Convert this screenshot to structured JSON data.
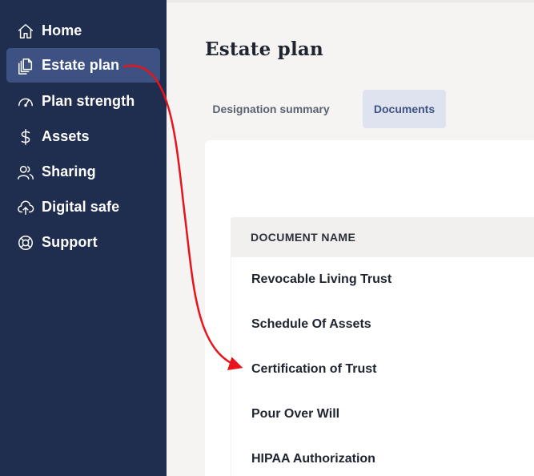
{
  "sidebar": {
    "items": [
      {
        "label": "Home",
        "icon": "home-icon"
      },
      {
        "label": "Estate plan",
        "icon": "documents-icon",
        "active": true
      },
      {
        "label": "Plan strength",
        "icon": "gauge-icon"
      },
      {
        "label": "Assets",
        "icon": "dollar-icon"
      },
      {
        "label": "Sharing",
        "icon": "people-icon"
      },
      {
        "label": "Digital safe",
        "icon": "cloud-upload-icon"
      },
      {
        "label": "Support",
        "icon": "lifebuoy-icon"
      }
    ]
  },
  "main": {
    "title": "Estate plan",
    "tabs": [
      {
        "label": "Designation summary",
        "active": false
      },
      {
        "label": "Documents",
        "active": true
      }
    ],
    "table": {
      "header": "DOCUMENT NAME",
      "rows": [
        "Revocable Living Trust",
        "Schedule Of Assets",
        "Certification of Trust",
        "Pour Over Will",
        "HIPAA Authorization"
      ]
    }
  },
  "colors": {
    "sidebar_bg": "#1f2d4e",
    "sidebar_active": "#3d5283",
    "tab_active_bg": "#dfe3ef",
    "arrow": "#e8141c"
  }
}
